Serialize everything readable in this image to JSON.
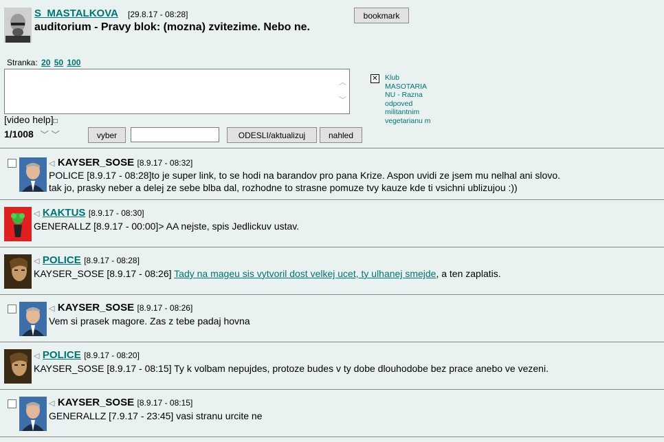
{
  "header": {
    "username": "S_MASTALKOVA",
    "date": "[29.8.17 - 08:28]",
    "title": "auditorium - Pravy blok: (mozna) zvitezime. Nebo ne.",
    "bookmark_label": "bookmark"
  },
  "paging": {
    "label": "Stranka:",
    "options": [
      "20",
      "50",
      "100"
    ]
  },
  "compose": {
    "video_help": "[video help]",
    "video_help_marker": "□",
    "counter": "1/1008",
    "vyber_label": "vyber",
    "search_value": "",
    "odesli_label": "ODESLI/aktualizuj",
    "nahled_label": "nahled"
  },
  "side": {
    "close_glyph": "✕",
    "klub_text": "Klub MASOTARIA NU - Razna odpoved militantnim vegetarianu m"
  },
  "posts": [
    {
      "user": "KAYSER_SOSE",
      "date": "[8.9.17 - 08:32]",
      "line1": "POLICE [8.9.17 - 08:28]to je super link, to se hodi na barandov pro pana Krize. Aspon uvidi ze jsem mu nelhal ani slovo.",
      "line2": "tak jo, prasky neber a delej ze sebe blba dal, rozhodne to strasne pomuze tvy kauze kde ti vsichni ublizujou :))"
    },
    {
      "user": "KAKTUS",
      "date": "[8.9.17 - 08:30]",
      "line1": "GENERALLZ [8.9.17 - 00:00]> AA nejste, spis Jedlickuv ustav."
    },
    {
      "user": "POLICE",
      "date": "[8.9.17 - 08:28]",
      "pre": "KAYSER_SOSE [8.9.17 - 08:26] ",
      "link": "Tady na mageu sis vytvoril dost velkej ucet, ty ulhanej smejde",
      "post": ", a ten zaplatis."
    },
    {
      "user": "KAYSER_SOSE",
      "date": "[8.9.17 - 08:26]",
      "line1": "Vem si prasek magore. Zas z tebe padaj hovna"
    },
    {
      "user": "POLICE",
      "date": "[8.9.17 - 08:20]",
      "line1": "KAYSER_SOSE [8.9.17 - 08:15] Ty k volbam nepujdes, protoze budes v ty dobe dlouhodobe bez prace anebo ve vezeni."
    },
    {
      "user": "KAYSER_SOSE",
      "date": "[8.9.17 - 08:15]",
      "line1": "GENERALLZ [7.9.17 - 23:45] vasi stranu urcite ne"
    }
  ],
  "glyphs": {
    "speaker": "◁",
    "scroll_up": "︿",
    "scroll_down": "﹀",
    "chevron": "﹀"
  },
  "colors": {
    "background": "#e9f1f1",
    "link": "#007373",
    "kaktus_bg": "#e02020"
  }
}
